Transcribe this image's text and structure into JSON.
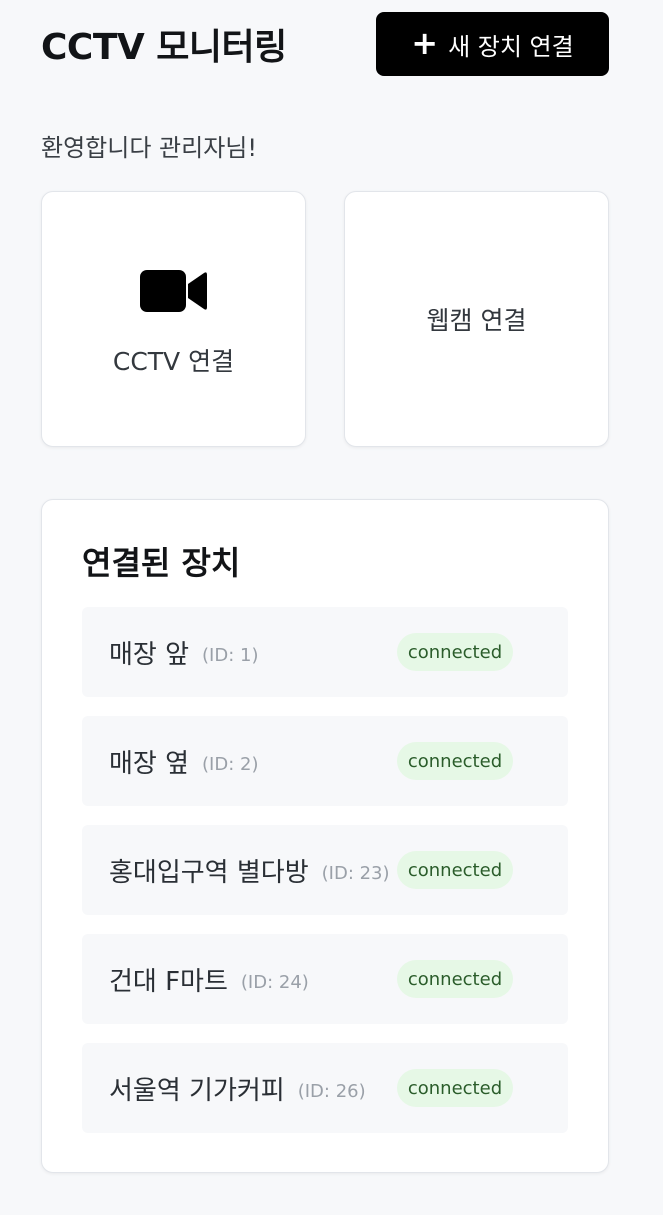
{
  "header": {
    "title": "CCTV 모니터링",
    "new_device_icon": "plus-icon",
    "new_device_label": "새 장치 연결"
  },
  "welcome": "환영합니다 관리자님!",
  "connect_options": {
    "cctv": {
      "icon": "video-camera-icon",
      "label": "CCTV 연결"
    },
    "webcam": {
      "label": "웹캠 연결"
    }
  },
  "devices_panel": {
    "title": "연결된 장치",
    "devices": [
      {
        "name": "매장 앞",
        "id": "(ID: 1)",
        "status": "connected"
      },
      {
        "name": "매장 옆",
        "id": "(ID: 2)",
        "status": "connected"
      },
      {
        "name": "홍대입구역 별다방",
        "id": "(ID: 23)",
        "status": "connected"
      },
      {
        "name": "건대 F마트",
        "id": "(ID: 24)",
        "status": "connected"
      },
      {
        "name": "서울역 기가커피",
        "id": "(ID: 26)",
        "status": "connected"
      }
    ]
  },
  "colors": {
    "button_bg": "#000000",
    "status_bg": "#e6f8e6",
    "status_text": "#2b5d2b"
  }
}
